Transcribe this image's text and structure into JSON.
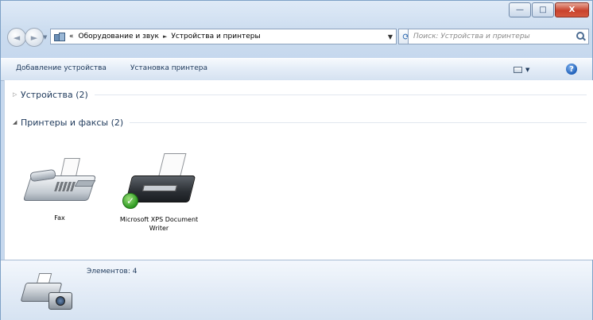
{
  "window": {
    "caption_buttons": {
      "minimize": "—",
      "maximize": "□",
      "close": "X"
    }
  },
  "navigation": {
    "back_symbol": "◄",
    "forward_symbol": "►"
  },
  "address_bar": {
    "overflow": "«",
    "crumbs": [
      "Оборудование и звук",
      "Устройства и принтеры"
    ],
    "separator": "►",
    "dropdown": "▼",
    "refresh_symbol": "⟳"
  },
  "search": {
    "placeholder": "Поиск: Устройства и принтеры"
  },
  "command_bar": {
    "add_device": "Добавление устройства",
    "add_printer": "Установка принтера",
    "view_dropdown": "▼",
    "help": "?"
  },
  "groups": {
    "devices": {
      "label": "Устройства (2)",
      "collapsed": true,
      "expander": "▷"
    },
    "printers": {
      "label": "Принтеры и факсы (2)",
      "collapsed": false,
      "expander": "◢"
    }
  },
  "printers": [
    {
      "name": "Fax",
      "icon": "fax-icon",
      "default": false
    },
    {
      "name": "Microsoft XPS Document Writer",
      "icon": "printer-icon",
      "default": true,
      "default_mark": "✓"
    }
  ],
  "details_pane": {
    "item_count": "Элементов: 4",
    "icon": "devices-and-printers-icon"
  },
  "colors": {
    "link_text": "#1e395b",
    "frame": "#c6d8ee",
    "close_button": "#c8422c",
    "default_check": "#2f9a22"
  }
}
